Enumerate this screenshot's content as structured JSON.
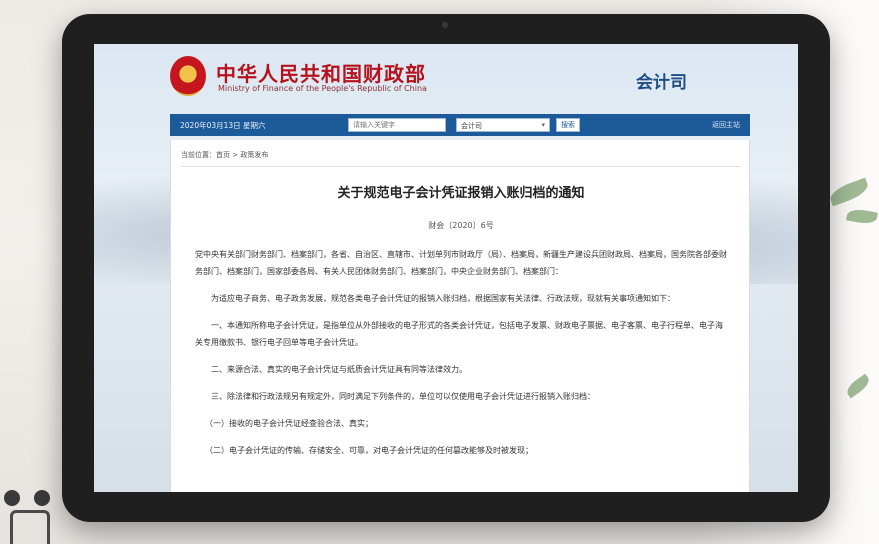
{
  "header": {
    "ministry_cn": "中华人民共和国财政部",
    "ministry_en": "Ministry of Finance of the People's Republic of China",
    "department": "会计司"
  },
  "navbar": {
    "date": "2020年03月13日  星期六",
    "search_placeholder": "请输入关键字",
    "select_value": "会计司",
    "search_button": "搜索",
    "right_link": "返回主站"
  },
  "breadcrumb": "当前位置：首页 > 政策发布",
  "document": {
    "title": "关于规范电子会计凭证报销入账归档的通知",
    "doc_number": "财会〔2020〕6号",
    "addressee": "党中央有关部门财务部门、档案部门，各省、自治区、直辖市、计划单列市财政厅（局）、档案局，新疆生产建设兵团财政局、档案局，国务院各部委财务部门、档案部门，国家部委各局、有关人民团体财务部门、档案部门，中央企业财务部门、档案部门：",
    "intro": "为适应电子商务、电子政务发展，规范各类电子会计凭证的报销入账归档，根据国家有关法律、行政法规，现就有关事项通知如下：",
    "item1": "一、本通知所称电子会计凭证，是指单位从外部接收的电子形式的各类会计凭证，包括电子发票、财政电子票据、电子客票、电子行程单、电子海关专用缴款书、银行电子回单等电子会计凭证。",
    "item2": "二、来源合法、真实的电子会计凭证与纸质会计凭证具有同等法律效力。",
    "item3": "三、除法律和行政法规另有规定外，同时满足下列条件的，单位可以仅使用电子会计凭证进行报销入账归档：",
    "sub1": "（一）接收的电子会计凭证经查验合法、真实；",
    "sub2": "（二）电子会计凭证的传输、存储安全、可靠，对电子会计凭证的任何篡改能够及时被发现；"
  }
}
